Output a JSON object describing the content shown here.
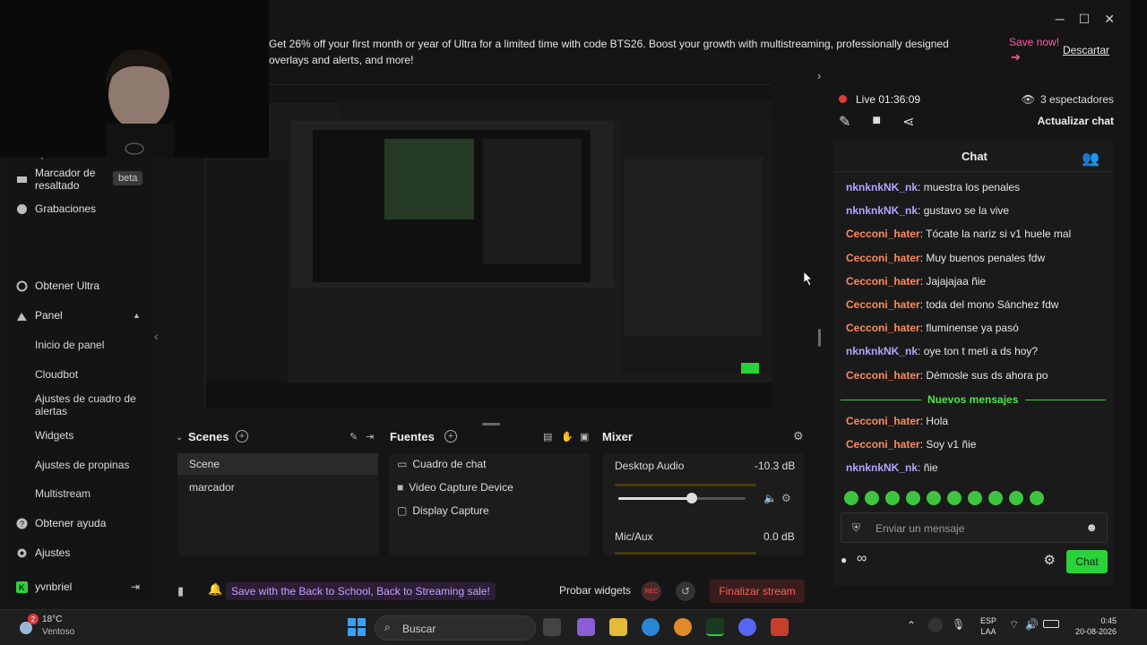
{
  "promo": {
    "text": "Get 26% off your first month or year of Ultra for a limited time with code BTS26. Boost your growth with multistreaming, professionally designed overlays and alerts, and more!",
    "save_label": "Save now!",
    "save_arrow": "➔",
    "dismiss_label": "Descartar"
  },
  "window_controls": {
    "minimize": "─",
    "maximize": "☐",
    "close": "✕"
  },
  "sidebar": {
    "top_partial": "aplicaciones",
    "highlight_marker": "Marcador de resaltado",
    "beta": "beta",
    "recordings": "Grabaciones",
    "get_ultra": "Obtener Ultra",
    "panel": "Panel",
    "sub_items": [
      "Inicio de panel",
      "Cloudbot",
      "Ajustes de cuadro de alertas",
      "Widgets",
      "Ajustes de propinas",
      "Multistream"
    ],
    "help": "Obtener ayuda",
    "settings": "Ajustes",
    "user": "yvnbriel",
    "collapse_glyph": "‹",
    "expand_glyph": "›"
  },
  "scenes": {
    "title": "Scenes",
    "items": [
      "Scene",
      "marcador"
    ]
  },
  "sources": {
    "title": "Fuentes",
    "items": [
      {
        "label": "Cuadro de chat",
        "icon": "chat-box-icon"
      },
      {
        "label": "Video Capture Device",
        "icon": "camera-icon"
      },
      {
        "label": "Display Capture",
        "icon": "monitor-icon"
      }
    ]
  },
  "mixer": {
    "title": "Mixer",
    "channels": [
      {
        "label": "Desktop Audio",
        "db": "-10.3 dB",
        "level": 0.58
      },
      {
        "label": "Mic/Aux",
        "db": "0.0 dB",
        "level": 0.7
      }
    ]
  },
  "footer": {
    "sale": "Save with the Back to School, Back to Streaming sale!",
    "test_widgets": "Probar widgets",
    "rec": "REC",
    "end_stream": "Finalizar stream"
  },
  "live": {
    "label": "Live",
    "time": "01:36:09",
    "viewers": "3 espectadores",
    "refresh": "Actualizar chat"
  },
  "chat": {
    "title": "Chat",
    "messages": [
      {
        "user": "nknknkNK_nk",
        "text": ": muestra los penales",
        "color": "#b3a5ff"
      },
      {
        "user": "nknknkNK_nk",
        "text": ": gustavo se la vive",
        "color": "#b3a5ff"
      },
      {
        "user": "Cecconi_hater",
        "text": ": Tócate la nariz si v1 huele mal",
        "color": "#ff8a5c"
      },
      {
        "user": "Cecconi_hater",
        "text": ": Muy buenos penales fdw",
        "color": "#ff8a5c"
      },
      {
        "user": "Cecconi_hater",
        "text": ": Jajajajaa ñie",
        "color": "#ff8a5c"
      },
      {
        "user": "Cecconi_hater",
        "text": ": toda del mono Sánchez fdw",
        "color": "#ff8a5c"
      },
      {
        "user": "Cecconi_hater",
        "text": ": fluminense ya pasó",
        "color": "#ff8a5c"
      },
      {
        "user": "nknknkNK_nk",
        "text": ": oye ton t meti a ds hoy?",
        "color": "#b3a5ff"
      },
      {
        "user": "Cecconi_hater",
        "text": ": Démosle sus ds ahora po",
        "color": "#ff8a5c"
      }
    ],
    "new_messages": "Nuevos mensajes",
    "new_msgs": [
      {
        "user": "Cecconi_hater",
        "text": ": Hola",
        "color": "#ff8a5c"
      },
      {
        "user": "Cecconi_hater",
        "text": ": Soy v1 ñie",
        "color": "#ff8a5c"
      },
      {
        "user": "nknknkNK_nk",
        "text": ": ñie",
        "color": "#b3a5ff"
      }
    ],
    "input_placeholder": "Enviar un mensaje",
    "infinity": "∞",
    "send": "Chat"
  },
  "taskbar": {
    "temp": "18°C",
    "desc": "Ventoso",
    "badge": "2",
    "search": "Buscar",
    "lang": [
      "ESP",
      "LAA"
    ],
    "time": "0:45",
    "date": "20-08-2026"
  },
  "colors": {
    "accent_green": "#2bd13a",
    "live_red": "#e23b3b",
    "promo_pink": "#ff5bac"
  }
}
